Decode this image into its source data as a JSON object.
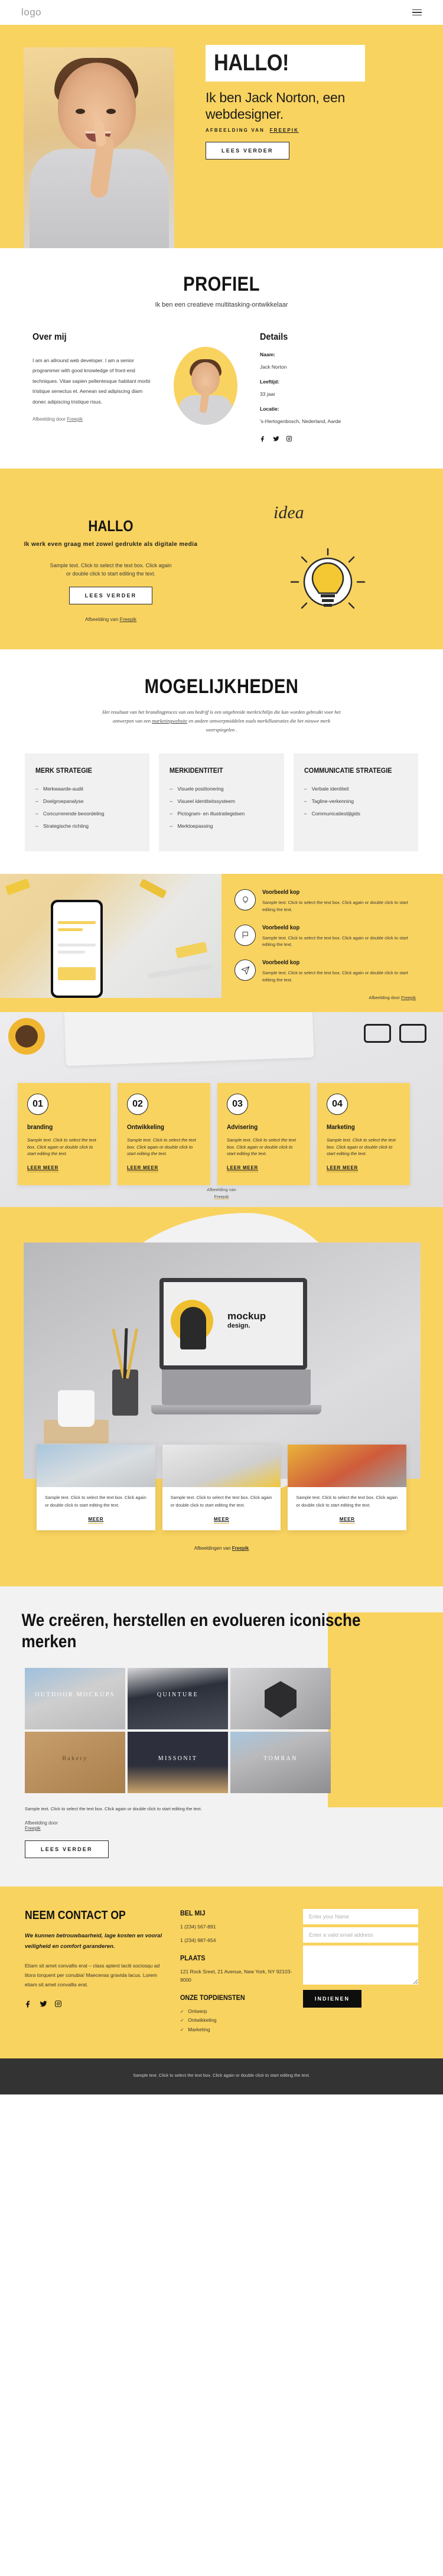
{
  "header": {
    "logo": "logo",
    "menu_icon": "hamburger-menu"
  },
  "hero": {
    "badge": "HALLO!",
    "headline": "Ik ben Jack Norton, een webdesigner.",
    "credit_prefix": "AFBEELDING VAN",
    "credit_link": "FREEPIK",
    "cta": "LEES VERDER"
  },
  "profiel": {
    "title": "PROFIEL",
    "subtitle": "Ik ben een creatieve multitasking-ontwikkelaar",
    "about_heading": "Over mij",
    "about_body": "I am an allround web developer. I am a senior programmer with good knowledge of front-end techniques. Vitae sapien pellentesque habitant morbi tristique senectus et. Aenean sed adipiscing diam donec adipiscing tristique risus.",
    "about_credit_prefix": "Afbeelding door ",
    "about_credit_link": "Freepik",
    "details_heading": "Details",
    "details": [
      {
        "label": "Naam:",
        "value": "Jack Norton"
      },
      {
        "label": "Leeftijd:",
        "value": "33 jaar"
      },
      {
        "label": "Locatie:",
        "value": "'s-Hertogenbosch, Nederland, Aarde"
      }
    ],
    "socials": [
      "facebook-icon",
      "twitter-icon",
      "instagram-icon"
    ]
  },
  "hallo": {
    "title": "HALLO",
    "tagline": "Ik werk even graag met zowel gedrukte als digitale media",
    "body": "Sample text. Click to select the text box. Click again or double click to start editing the text.",
    "cta": "LEES VERDER",
    "credit_prefix": "Afbeelding van ",
    "credit_link": "Freepik",
    "idea_word": "idea"
  },
  "mogelijkheden": {
    "title": "MOGELIJKHEDEN",
    "description_a": "Het resultaat van het brandingproces van ons bedrijf is een uitgebreide merkrichtlijn die kan worden gebruikt voor het ontwerpen van een ",
    "description_link": "marketingwebsite",
    "description_b": " en andere ontwerpmiddelen zoals merkillustraties die het nieuwe merk weerspiegelen .",
    "cards": [
      {
        "title": "MERK STRATEGIE",
        "items": [
          "Merkwaarde-audit",
          "Doelgroepanalyse",
          "Concurrerende beoordeling",
          "Strategische richting"
        ]
      },
      {
        "title": "MERKIDENTITEIT",
        "items": [
          "Visuele positionering",
          "Visueel identiteitssysteem",
          "Pictogram- en illustratiegidsen",
          "Merktoepassing"
        ]
      },
      {
        "title": "COMMUNICATIE STRATEGIE",
        "items": [
          "Verbale identiteit",
          "Tagline-verkenning",
          "Communicatiestijlgids"
        ]
      }
    ]
  },
  "features": {
    "items": [
      {
        "icon": "lightbulb-icon",
        "title": "Voorbeeld kop",
        "body": "Sample text. Click to select the text box. Click again or double click to start editing the text."
      },
      {
        "icon": "flag-icon",
        "title": "Voorbeeld kop",
        "body": "Sample text. Click to select the text box. Click again or double click to start editing the text."
      },
      {
        "icon": "paper-plane-icon",
        "title": "Voorbeeld kop",
        "body": "Sample text. Click to select the text box. Click again or double click to start editing the text."
      }
    ],
    "credit_prefix": "Afbeelding door ",
    "credit_link": "Freepik"
  },
  "services": {
    "cards": [
      {
        "num": "01",
        "title": "branding",
        "body": "Sample text. Click to select the text box. Click again or double click to start editing the text.",
        "link": "LEER MEER"
      },
      {
        "num": "02",
        "title": "Ontwikkeling",
        "body": "Sample text. Click to select the text box. Click again or double click to start editing the text.",
        "link": "LEER MEER"
      },
      {
        "num": "03",
        "title": "Advisering",
        "body": "Sample text. Click to select the text box. Click again or double click to start editing the text.",
        "link": "LEER MEER"
      },
      {
        "num": "04",
        "title": "Marketing",
        "body": "Sample text. Click to select the text box. Click again or double click to start editing the text.",
        "link": "LEER MEER"
      }
    ],
    "credit_prefix": "Afbeelding van",
    "credit_link": "Freepik"
  },
  "showcase": {
    "mockup_title": "mockup",
    "mockup_sub": "design.",
    "thumbs": [
      {
        "body": "Sample text. Click to select the text box. Click again or double click to start editing the text.",
        "link": "MEER"
      },
      {
        "body": "Sample text. Click to select the text box. Click again or double click to start editing the text.",
        "link": "MEER"
      },
      {
        "body": "Sample text. Click to select the text box. Click again or double click to start editing the text.",
        "link": "MEER"
      }
    ],
    "credit_prefix": "Afbeeldingen van ",
    "credit_link": "Freepik"
  },
  "brands": {
    "heading": "We creëren, herstellen en evolueren iconische merken",
    "tiles": [
      {
        "label": "OUTDOOR MOCKUPS",
        "style": "bc1"
      },
      {
        "label": "QUINTURE",
        "style": "bc2"
      },
      {
        "label": "",
        "style": "bc3"
      },
      {
        "label": "Bakery",
        "style": "bc4"
      },
      {
        "label": "MISSONIT",
        "style": "bc5"
      },
      {
        "label": "TOMRAN",
        "style": "bc6"
      }
    ],
    "body": "Sample text. Click to select the text box. Click again or double click to start editing the text.",
    "credit_prefix": "Afbeelding door",
    "credit_link": "Freepik",
    "cta": "LEES VERDER"
  },
  "contact": {
    "title": "NEEM CONTACT OP",
    "lead": "We kunnen betrouwbaarheid, lage kosten en vooral veiligheid en comfort garanderen.",
    "body": "Etiam sit amet convallis erat – class aptent taciti sociosqu ad litora torquent per conubia! Maecenas gravida lacus. Lorem etiam sit amet convallis erat.",
    "socials": [
      "facebook-icon",
      "twitter-icon",
      "instagram-icon"
    ],
    "call_heading": "BEL MIJ",
    "phone_1": "1 (234) 567-891",
    "phone_2": "1 (234) 987-654",
    "place_heading": "PLAATS",
    "address": "121 Rock Sreet, 21 Avenue, New York, NY 92103-9000",
    "services_heading": "ONZE TOPDIENSTEN",
    "services": [
      "Ontwerp",
      "Ontwikkeling",
      "Marketing"
    ],
    "form": {
      "name_placeholder": "Enter your Name",
      "email_placeholder": "Enter a valid email address",
      "message_placeholder": "",
      "submit": "INDIENEN"
    }
  },
  "footer": {
    "text": "Sample text. Click to select the text box. Click again or double click to start editing the text."
  }
}
